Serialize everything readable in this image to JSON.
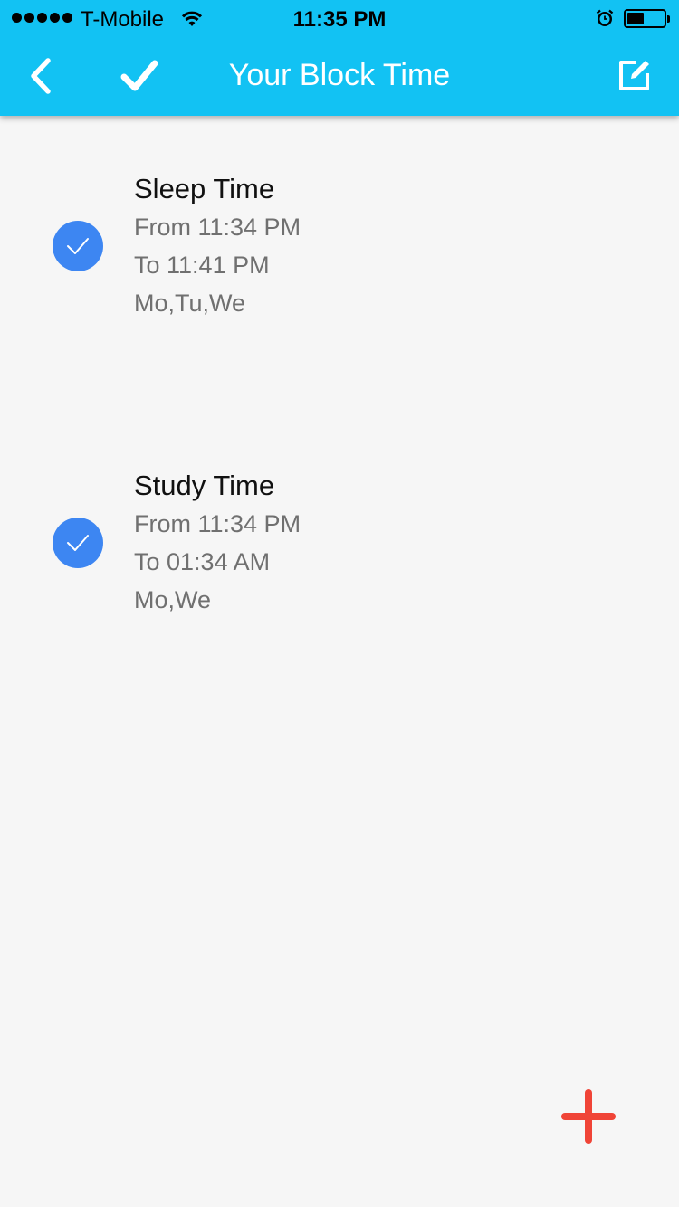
{
  "status_bar": {
    "carrier": "T-Mobile",
    "time": "11:35 PM",
    "battery_level": 0.45
  },
  "nav": {
    "title": "Your Block Time",
    "back_icon": "chevron-left-icon",
    "confirm_icon": "checkmark-icon",
    "edit_icon": "edit-icon"
  },
  "block_times": [
    {
      "title": "Sleep Time",
      "from": "From 11:34 PM",
      "to": "To 11:41 PM",
      "days": "Mo,Tu,We",
      "enabled": true
    },
    {
      "title": "Study Time",
      "from": "From 11:34 PM",
      "to": "To 01:34 AM",
      "days": "Mo,We",
      "enabled": true
    }
  ],
  "colors": {
    "header": "#12c2f3",
    "check": "#3d86f2",
    "add": "#f04437",
    "background": "#f6f6f6"
  }
}
